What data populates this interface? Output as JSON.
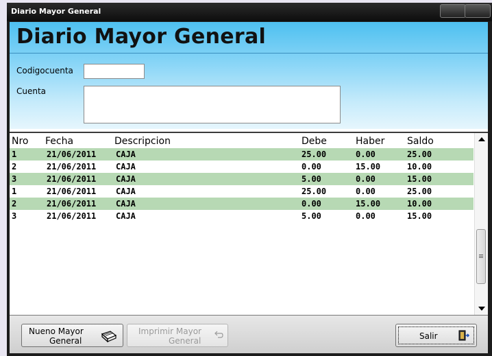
{
  "window": {
    "title": "Diario Mayor General"
  },
  "header": {
    "title": "Diario Mayor General",
    "codigo_label": "Codigocuenta",
    "codigo_value": "",
    "cuenta_label": "Cuenta",
    "cuenta_value": ""
  },
  "grid": {
    "columns": [
      "Nro",
      "Fecha",
      "Descripcion",
      "Debe",
      "Haber",
      "Saldo"
    ],
    "rows": [
      [
        "1",
        "21/06/2011",
        "CAJA",
        "25.00",
        "0.00",
        "25.00"
      ],
      [
        "2",
        "21/06/2011",
        "CAJA",
        "0.00",
        "15.00",
        "10.00"
      ],
      [
        "3",
        "21/06/2011",
        "CAJA",
        "5.00",
        "0.00",
        "15.00"
      ],
      [
        "1",
        "21/06/2011",
        "CAJA",
        "25.00",
        "0.00",
        "25.00"
      ],
      [
        "2",
        "21/06/2011",
        "CAJA",
        "0.00",
        "15.00",
        "10.00"
      ],
      [
        "3",
        "21/06/2011",
        "CAJA",
        "5.00",
        "0.00",
        "15.00"
      ]
    ]
  },
  "buttons": {
    "nuevo_l1": "Nueno Mayor",
    "nuevo_l2": "General",
    "imprimir_l1": "Imprimir Mayor",
    "imprimir_l2": "General",
    "salir": "Salir"
  },
  "colors": {
    "header_top": "#4ec0f0",
    "row_alt": "#b7d9b4",
    "titlebar": "#1c1c1c"
  }
}
